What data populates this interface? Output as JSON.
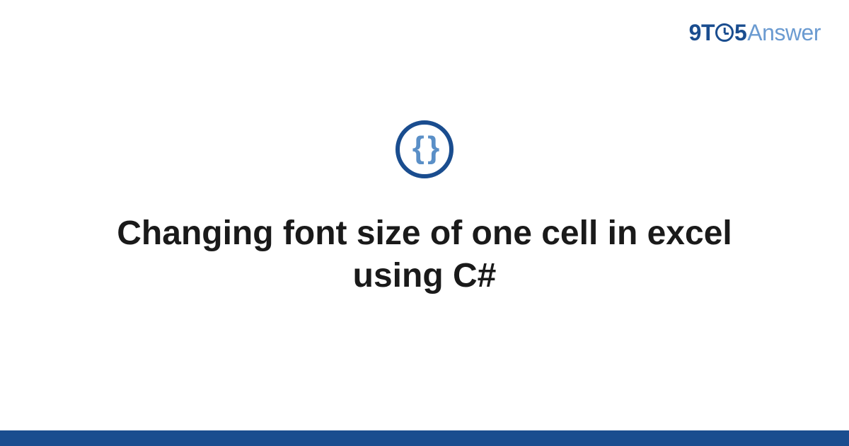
{
  "logo": {
    "part1": "9T",
    "part2": "5",
    "part3": "Answer"
  },
  "icon": {
    "glyph": "{ }"
  },
  "title": "Changing font size of one cell in excel using C#"
}
